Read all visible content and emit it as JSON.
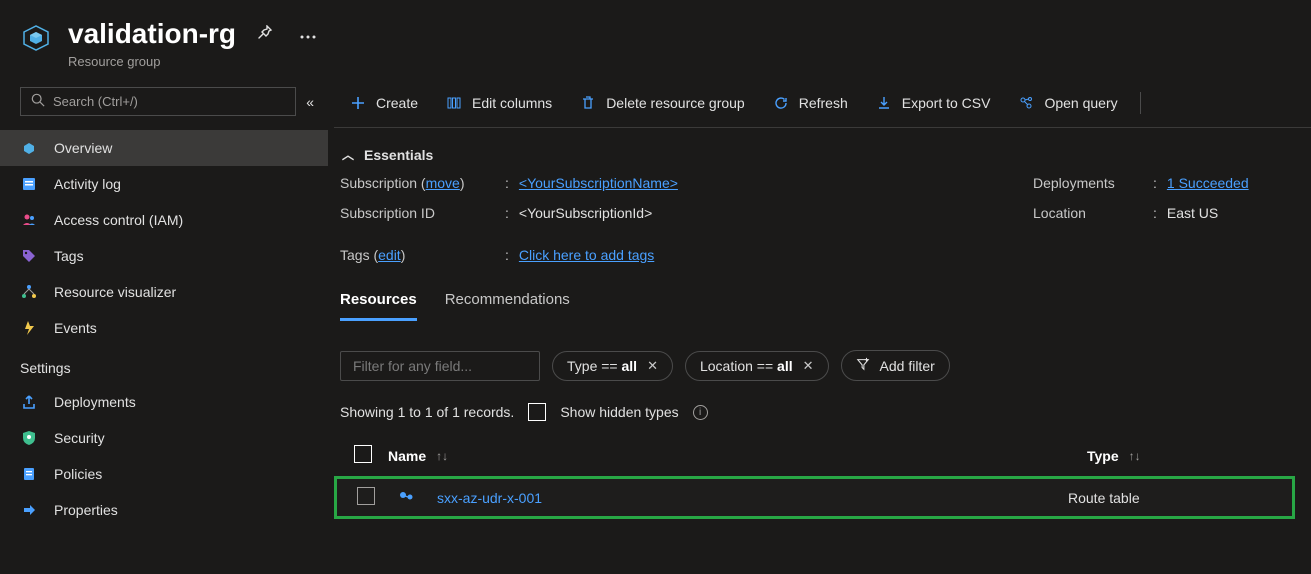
{
  "header": {
    "title": "validation-rg",
    "subtitle": "Resource group"
  },
  "search": {
    "placeholder": "Search (Ctrl+/)"
  },
  "nav": {
    "primary": [
      {
        "label": "Overview"
      },
      {
        "label": "Activity log"
      },
      {
        "label": "Access control (IAM)"
      },
      {
        "label": "Tags"
      },
      {
        "label": "Resource visualizer"
      },
      {
        "label": "Events"
      }
    ],
    "settings_label": "Settings",
    "settings": [
      {
        "label": "Deployments"
      },
      {
        "label": "Security"
      },
      {
        "label": "Policies"
      },
      {
        "label": "Properties"
      }
    ]
  },
  "cmd": {
    "create": "Create",
    "editcols": "Edit columns",
    "delete": "Delete resource group",
    "refresh": "Refresh",
    "export": "Export to CSV",
    "openquery": "Open query"
  },
  "essentials": {
    "title": "Essentials",
    "subscription_label": "Subscription (",
    "subscription_move": "move",
    "subscription_label_close": ")",
    "subscription_value": "<YourSubscriptionName>",
    "subid_label": "Subscription ID",
    "subid_value": "<YourSubscriptionId>",
    "tags_label": "Tags (",
    "tags_edit": "edit",
    "tags_label_close": ")",
    "tags_value": "Click here to add tags",
    "deployments_label": "Deployments",
    "deployments_value": "1 Succeeded",
    "location_label": "Location",
    "location_value": "East US"
  },
  "tabs": {
    "resources": "Resources",
    "recommendations": "Recommendations"
  },
  "filters": {
    "field_placeholder": "Filter for any field...",
    "type_pre": "Type == ",
    "type_val": "all",
    "loc_pre": "Location == ",
    "loc_val": "all",
    "add": "Add filter"
  },
  "status": {
    "records": "Showing 1 to 1 of 1 records.",
    "hidden_label": "Show hidden types"
  },
  "table": {
    "col_name": "Name",
    "col_type": "Type",
    "rows": [
      {
        "name": "sxx-az-udr-x-001",
        "type": "Route table"
      }
    ]
  }
}
